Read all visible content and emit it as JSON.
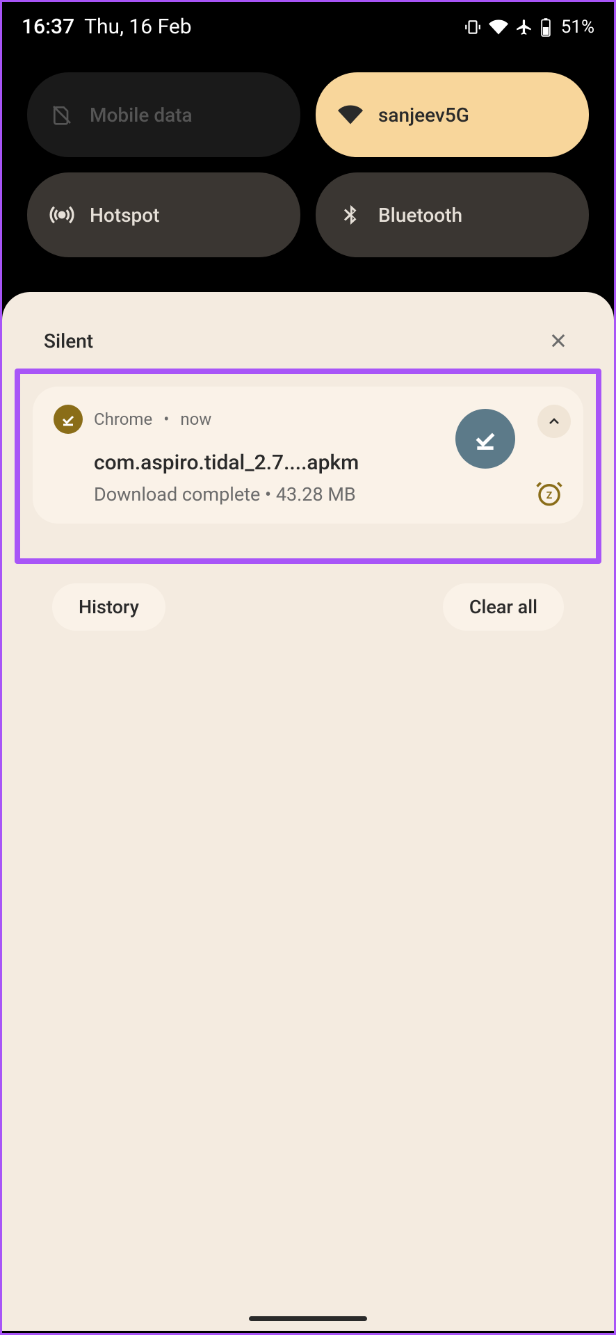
{
  "status": {
    "time": "16:37",
    "date": "Thu, 16 Feb",
    "battery": "51%"
  },
  "qs": {
    "mobile_data": "Mobile data",
    "wifi": "sanjeev5G",
    "hotspot": "Hotspot",
    "bluetooth": "Bluetooth"
  },
  "section": {
    "title": "Silent"
  },
  "notification": {
    "app": "Chrome",
    "time": "now",
    "title": "com.aspiro.tidal_2.7....apkm",
    "status": "Download complete",
    "size": "43.28 MB"
  },
  "footer": {
    "history": "History",
    "clear": "Clear all"
  }
}
